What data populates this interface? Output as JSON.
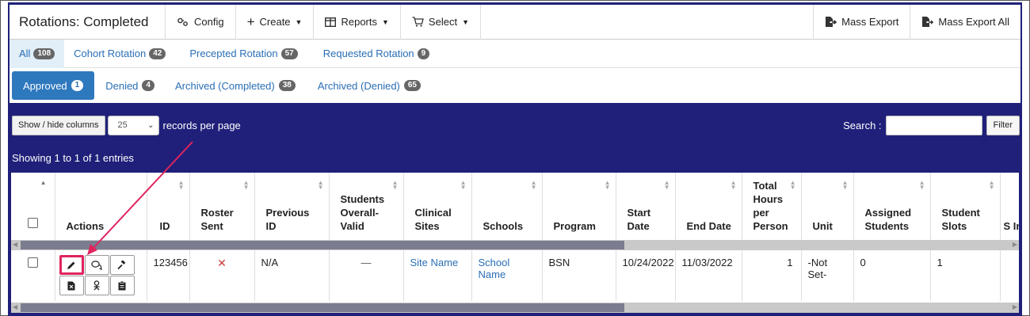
{
  "header": {
    "title": "Rotations: Completed",
    "config_label": "Config",
    "create_label": "Create",
    "reports_label": "Reports",
    "select_label": "Select",
    "mass_export_label": "Mass Export",
    "mass_export_all_label": "Mass Export All"
  },
  "category_tabs": [
    {
      "label": "All",
      "count": "108"
    },
    {
      "label": "Cohort Rotation",
      "count": "42"
    },
    {
      "label": "Precepted Rotation",
      "count": "57"
    },
    {
      "label": "Requested Rotation",
      "count": "9"
    }
  ],
  "status_tabs": [
    {
      "label": "Approved",
      "count": "1"
    },
    {
      "label": "Denied",
      "count": "4"
    },
    {
      "label": "Archived (Completed)",
      "count": "38"
    },
    {
      "label": "Archived (Denied)",
      "count": "65"
    }
  ],
  "controls": {
    "show_hide_label": "Show / hide columns",
    "page_size": "25",
    "records_per_page": "records per page",
    "search_label": "Search :",
    "filter_label": "Filter",
    "showing_text": "Showing 1 to 1 of 1 entries"
  },
  "table": {
    "headers": [
      "Actions",
      "ID",
      "Roster Sent",
      "Previous ID",
      "Students Overall-Valid",
      "Clinical Sites",
      "Schools",
      "Program",
      "Start Date",
      "End Date",
      "Total Hours per Person",
      "Unit",
      "Assigned Students",
      "Student Slots",
      "S In"
    ],
    "row": {
      "id": "123456",
      "roster_sent": "✕",
      "previous_id": "N/A",
      "students_valid": "—",
      "clinical_site": "Site Name",
      "school": "School Name",
      "program": "BSN",
      "start_date": "10/24/2022",
      "end_date": "11/03/2022",
      "total_hours": "1",
      "unit": "-Not Set-",
      "assigned_students": "0",
      "student_slots": "1"
    }
  },
  "colors": {
    "panel": "#20207a",
    "link": "#2a6eb5",
    "highlight": "#e0245e"
  }
}
